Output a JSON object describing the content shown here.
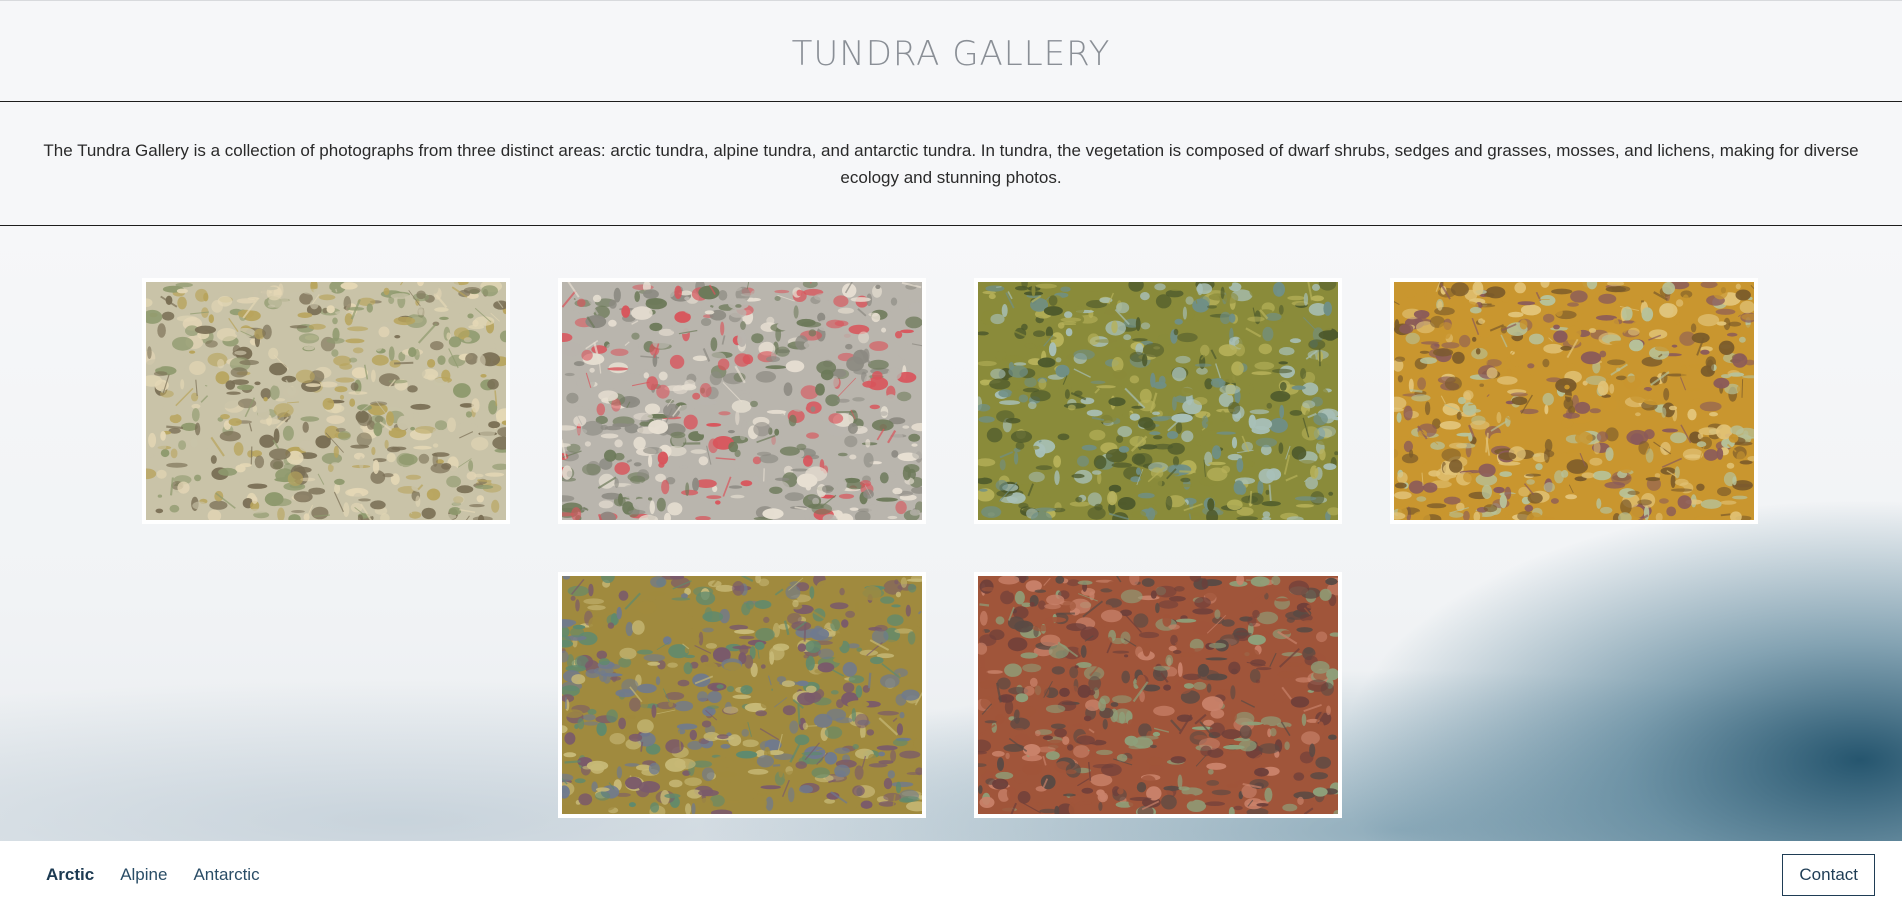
{
  "site": {
    "title": "TUNDRA GALLERY",
    "intro": "The Tundra Gallery is a collection of photographs from three distinct areas: arctic tundra, alpine tundra, and antarctic tundra. In tundra, the vegetation is composed of dwarf shrubs, sedges and grasses, mosses, and lichens, making for diverse ecology and stunning photos."
  },
  "gallery": {
    "photos": [
      {
        "subject": "tundra-groundcover-lichens-with-pinecone",
        "palette": [
          "#c9c3a8",
          "#8f9a6e",
          "#e4d7b5",
          "#b8a45c",
          "#7a6f55"
        ]
      },
      {
        "subject": "tundra-red-leaves-on-gravel",
        "palette": [
          "#b9b5ad",
          "#d9545b",
          "#8c8a82",
          "#e7dfd2",
          "#6d7a5a"
        ]
      },
      {
        "subject": "tundra-moss-with-mushroom",
        "palette": [
          "#8a8b3a",
          "#6f8f86",
          "#b7b25a",
          "#4e5a2c",
          "#a8c0b8"
        ]
      },
      {
        "subject": "tundra-golden-moss",
        "palette": [
          "#c9962f",
          "#7a5a2a",
          "#e2c479",
          "#8a5a5a",
          "#b7c29a"
        ]
      },
      {
        "subject": "tundra-mixed-moss-and-shrubs",
        "palette": [
          "#a08a3e",
          "#6f7a8f",
          "#c7b977",
          "#5f8a6e",
          "#7a5a6a"
        ]
      },
      {
        "subject": "tundra-red-moss",
        "palette": [
          "#a0553a",
          "#6e3f3a",
          "#c9826a",
          "#8ea07a",
          "#5a4a44"
        ]
      }
    ]
  },
  "nav": {
    "tabs": [
      {
        "label": "Arctic",
        "active": true
      },
      {
        "label": "Alpine",
        "active": false
      },
      {
        "label": "Antarctic",
        "active": false
      }
    ],
    "contact_label": "Contact"
  }
}
